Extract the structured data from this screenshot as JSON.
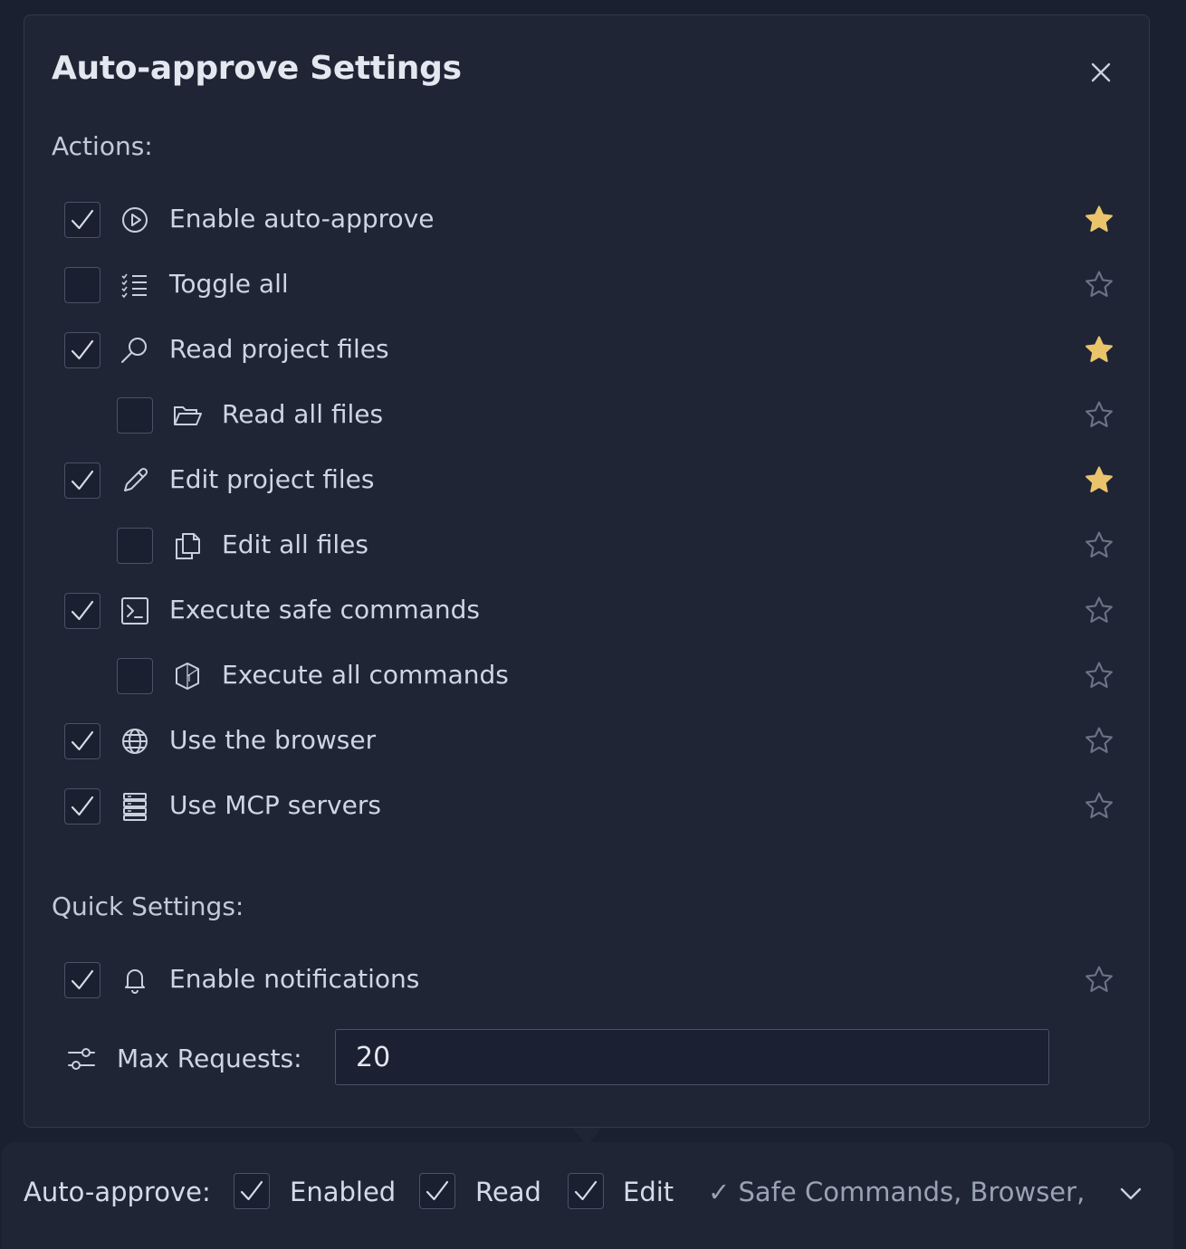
{
  "dialog": {
    "title": "Auto-approve Settings",
    "actions_heading": "Actions:",
    "quick_heading": "Quick Settings:"
  },
  "actions": [
    {
      "label": "Enable auto-approve",
      "icon": "play-circle-icon",
      "checked": true,
      "starred": true,
      "indent": false
    },
    {
      "label": "Toggle all",
      "icon": "checklist-icon",
      "checked": false,
      "starred": false,
      "indent": false
    },
    {
      "label": "Read project files",
      "icon": "search-icon",
      "checked": true,
      "starred": true,
      "indent": false
    },
    {
      "label": "Read all files",
      "icon": "folder-open-icon",
      "checked": false,
      "starred": false,
      "indent": true
    },
    {
      "label": "Edit project files",
      "icon": "pencil-icon",
      "checked": true,
      "starred": true,
      "indent": false
    },
    {
      "label": "Edit all files",
      "icon": "copy-files-icon",
      "checked": false,
      "starred": false,
      "indent": true
    },
    {
      "label": "Execute safe commands",
      "icon": "terminal-icon",
      "checked": true,
      "starred": false,
      "indent": false
    },
    {
      "label": "Execute all commands",
      "icon": "bash-shield-icon",
      "checked": false,
      "starred": false,
      "indent": true
    },
    {
      "label": "Use the browser",
      "icon": "globe-icon",
      "checked": true,
      "starred": false,
      "indent": false
    },
    {
      "label": "Use MCP servers",
      "icon": "server-icon",
      "checked": true,
      "starred": false,
      "indent": false
    }
  ],
  "quick": {
    "notifications": {
      "label": "Enable notifications",
      "icon": "bell-icon",
      "checked": true,
      "starred": false
    },
    "max_requests_label": "Max Requests:",
    "max_requests_value": "20"
  },
  "bottom_bar": {
    "label": "Auto-approve:",
    "items": [
      {
        "label": "Enabled",
        "checked": true
      },
      {
        "label": "Read",
        "checked": true
      },
      {
        "label": "Edit",
        "checked": true
      }
    ],
    "summary": "✓ Safe Commands, Browser,"
  },
  "colors": {
    "star_active": "#e9c46a",
    "star_inactive": "#6b7386",
    "background": "#1b2030",
    "panel": "#1f2535"
  }
}
